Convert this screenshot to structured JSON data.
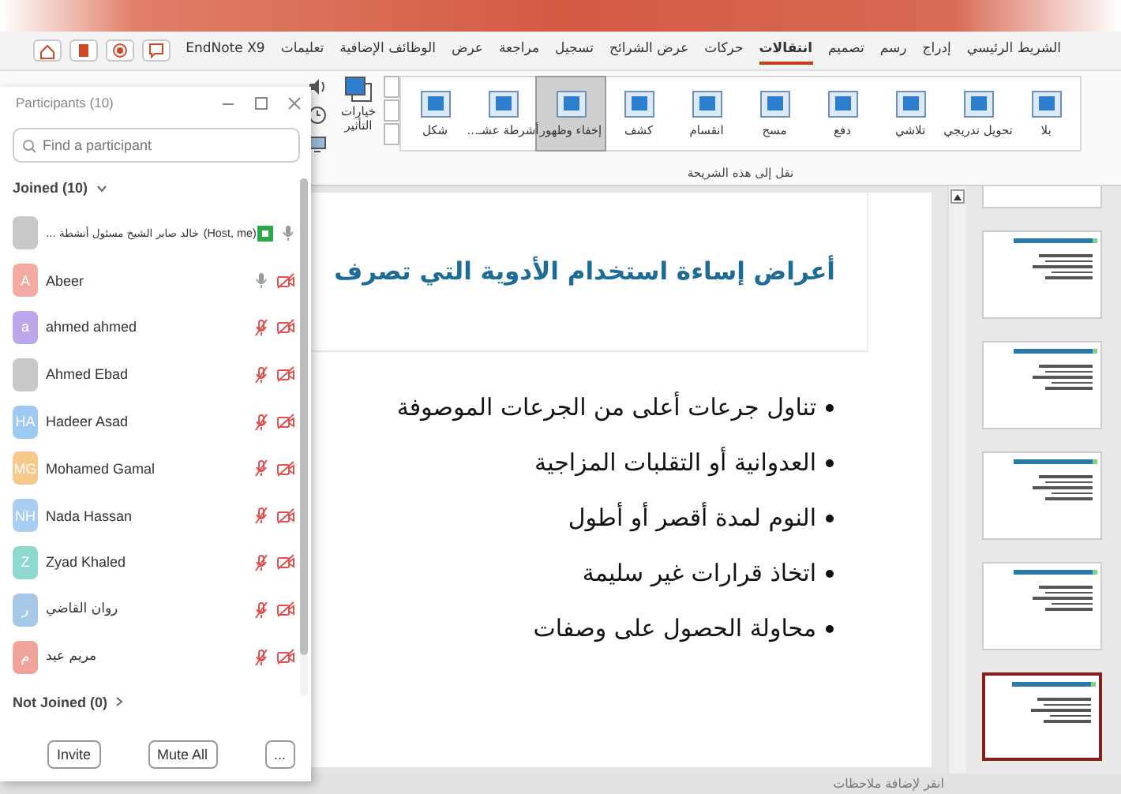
{
  "ribbon": {
    "tabs": [
      {
        "label": "الشريط الرئيسي",
        "selected": false
      },
      {
        "label": "إدراج",
        "selected": false
      },
      {
        "label": "رسم",
        "selected": false
      },
      {
        "label": "تصميم",
        "selected": false
      },
      {
        "label": "انتقالات",
        "selected": true
      },
      {
        "label": "حركات",
        "selected": false
      },
      {
        "label": "عرض الشرائح",
        "selected": false
      },
      {
        "label": "تسجيل",
        "selected": false
      },
      {
        "label": "مراجعة",
        "selected": false
      },
      {
        "label": "عرض",
        "selected": false
      },
      {
        "label": "الوظائف الإضافية",
        "selected": false
      },
      {
        "label": "تعليمات",
        "selected": false
      },
      {
        "label": "EndNote X9",
        "selected": false
      }
    ],
    "transitions": [
      {
        "label": "بلا",
        "selected": false
      },
      {
        "label": "تحويل تدريجي",
        "selected": false
      },
      {
        "label": "تلاشي",
        "selected": false
      },
      {
        "label": "دفع",
        "selected": false
      },
      {
        "label": "مسح",
        "selected": false
      },
      {
        "label": "انقسام",
        "selected": false
      },
      {
        "label": "كشف",
        "selected": false
      },
      {
        "label": "إخفاء وظهور",
        "selected": true
      },
      {
        "label": "أشرطة عشـ...",
        "selected": false
      },
      {
        "label": "شكل",
        "selected": false
      }
    ],
    "effect_options": "خيارات التأثير",
    "group_label": "نقل إلى هذه الشريحة"
  },
  "participants": {
    "title": "Participants (10)",
    "search": {
      "placeholder": "Find a participant"
    },
    "joined_header": "Joined (10)",
    "people": [
      {
        "name": "خالد صابر الشيخ مسئول أنشطة ...",
        "kind": "photo",
        "role": "(Host, me)",
        "video_on": true,
        "muted": false
      },
      {
        "name": "Abeer",
        "kind": "initials",
        "initials": "A",
        "color": "#f2aaa2",
        "video_on": false,
        "muted": false
      },
      {
        "name": "ahmed ahmed",
        "kind": "initials",
        "initials": "a",
        "color": "#bba8ea",
        "video_on": false,
        "muted": true
      },
      {
        "name": "Ahmed Ebad",
        "kind": "photo",
        "video_on": false,
        "muted": true
      },
      {
        "name": "Hadeer Asad",
        "kind": "initials",
        "initials": "HA",
        "color": "#9ccaf0",
        "video_on": false,
        "muted": true
      },
      {
        "name": "Mohamed Gamal",
        "kind": "initials",
        "initials": "MG",
        "color": "#f6c88c",
        "video_on": false,
        "muted": true
      },
      {
        "name": "Nada Hassan",
        "kind": "initials",
        "initials": "NH",
        "color": "#a8cef2",
        "video_on": false,
        "muted": true
      },
      {
        "name": "Zyad Khaled",
        "kind": "initials",
        "initials": "Z",
        "color": "#8fd8d0",
        "video_on": false,
        "muted": true
      },
      {
        "name": "روان القاضي",
        "kind": "initials",
        "initials": "ر",
        "color": "#a6c9e8",
        "video_on": false,
        "muted": true
      },
      {
        "name": "مريم عيد",
        "kind": "initials",
        "initials": "م",
        "color": "#f0a49c",
        "video_on": false,
        "muted": true
      }
    ],
    "not_joined_header": "Not Joined (0)",
    "invite_button": "Invite",
    "mute_all_button": "Mute All",
    "more_button": "..."
  },
  "slide": {
    "title": "أعراض إساءة استخدام الأدوية التي تصرف",
    "bullets": [
      "تناول جرعات أعلى من الجرعات الموصوفة",
      "العدوانية أو التقلبات المزاجية",
      "النوم لمدة أقصر أو أطول",
      "اتخاذ قرارات غير سليمة",
      "محاولة الحصول على وصفات"
    ]
  },
  "thumbnails": [
    {
      "selected": false
    },
    {
      "selected": false
    },
    {
      "selected": false
    },
    {
      "selected": false
    },
    {
      "selected": false
    },
    {
      "selected": true
    }
  ],
  "notes": {
    "placeholder": "انقر لإضافة ملاحظات"
  }
}
